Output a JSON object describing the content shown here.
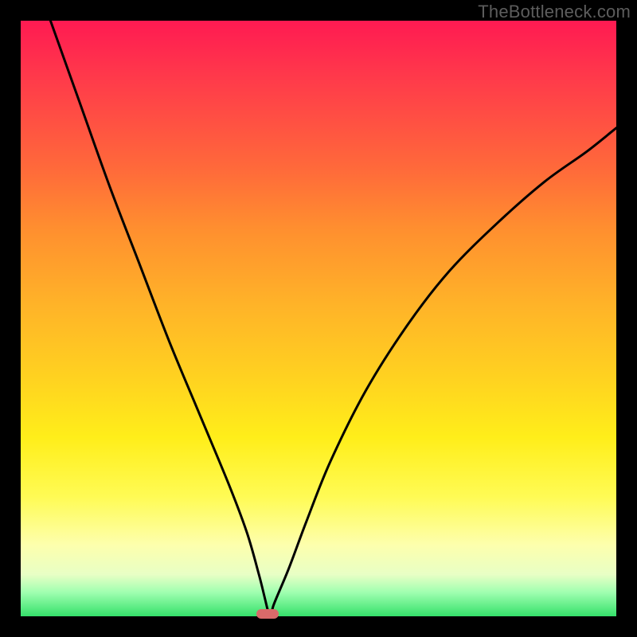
{
  "brand": "TheBottleneck.com",
  "chart_data": {
    "type": "line",
    "title": "",
    "xlabel": "",
    "ylabel": "",
    "xlim": [
      0,
      100
    ],
    "ylim": [
      0,
      100
    ],
    "series": [
      {
        "name": "curve",
        "x": [
          5,
          10,
          15,
          20,
          25,
          30,
          35,
          38,
          40,
          41,
          41.5,
          42,
          42.5,
          45,
          48,
          52,
          58,
          65,
          72,
          80,
          88,
          95,
          100
        ],
        "values": [
          100,
          86,
          72,
          59,
          46,
          34,
          22,
          14,
          7,
          3,
          1,
          0,
          2,
          8,
          16,
          26,
          38,
          49,
          58,
          66,
          73,
          78,
          82
        ]
      }
    ],
    "marker": {
      "x": 41.5,
      "y": 0
    },
    "gradient_stops": [
      {
        "pos": 0,
        "color": "#ff1a52"
      },
      {
        "pos": 50,
        "color": "#ffd220"
      },
      {
        "pos": 100,
        "color": "#35e06a"
      }
    ]
  }
}
